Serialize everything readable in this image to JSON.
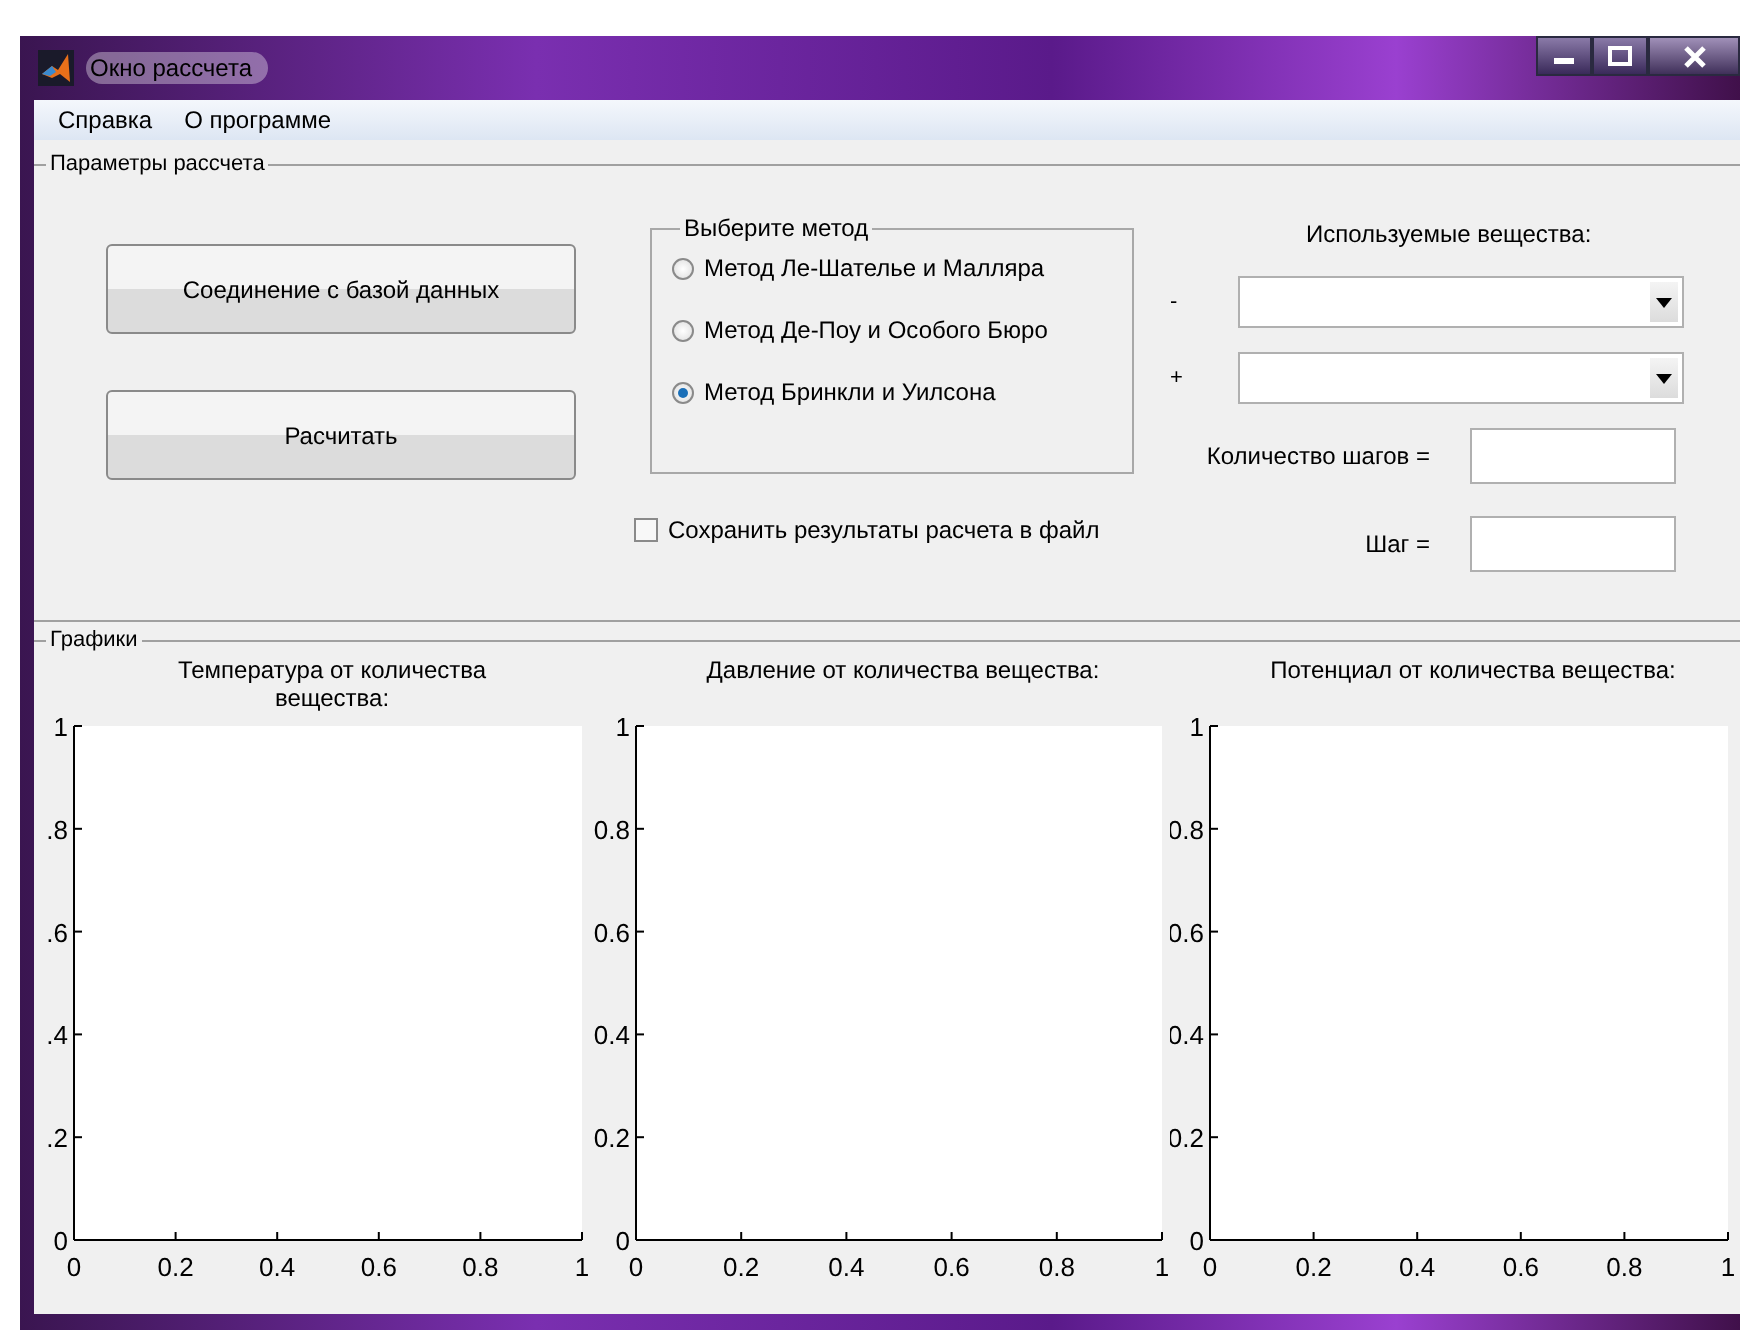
{
  "window": {
    "title": "Окно рассчета"
  },
  "menu": [
    "Справка",
    "О программе"
  ],
  "parameters_panel": {
    "title": "Параметры рассчета",
    "buttons": [
      "Соединение с базой данных",
      "Расчитать"
    ],
    "method_group": {
      "title": "Выберите метод",
      "options": [
        {
          "label": "Метод Ле-Шателье и Малляра",
          "selected": false
        },
        {
          "label": "Метод Де-Поу и Особого Бюро",
          "selected": false
        },
        {
          "label": "Метод Бринкли и Уилсона",
          "selected": true
        }
      ]
    },
    "save_checkbox": {
      "label": "Сохранить результаты расчета в файл",
      "checked": false
    },
    "substances": {
      "title": "Используемые вещества:",
      "dropdowns": [
        {
          "label": "-"
        },
        {
          "label": "+"
        }
      ]
    },
    "fields": [
      {
        "label": "Количество шагов ="
      },
      {
        "label": "Шаг ="
      }
    ]
  },
  "graphs_panel": {
    "title": "Графики",
    "charts": [
      {
        "chart_data": {
          "type": "line",
          "title": "Температура от количества вещества:",
          "xlim": [
            0,
            1
          ],
          "ylim": [
            0,
            1
          ],
          "xticks": [
            0,
            0.2,
            0.4,
            0.6,
            0.8,
            1
          ],
          "yticks": [
            {
              "value": 0,
              "label": "0"
            },
            {
              "value": 0.2,
              "label": ".2"
            },
            {
              "value": 0.4,
              "label": ".4"
            },
            {
              "value": 0.6,
              "label": ".6"
            },
            {
              "value": 0.8,
              "label": ".8"
            },
            {
              "value": 1,
              "label": "1"
            }
          ]
        }
      },
      {
        "chart_data": {
          "type": "line",
          "title": "Давление от количества вещества:",
          "xlim": [
            0,
            1
          ],
          "ylim": [
            0,
            1
          ],
          "xticks": [
            0,
            0.2,
            0.4,
            0.6,
            0.8,
            1
          ],
          "yticks": [
            0,
            0.2,
            0.4,
            0.6,
            0.8,
            1
          ]
        }
      },
      {
        "chart_data": {
          "type": "line",
          "title": "Потенциал от количества вещества:",
          "xlim": [
            0,
            1
          ],
          "ylim": [
            0,
            1
          ],
          "xticks": [
            0,
            0.2,
            0.4,
            0.6,
            0.8,
            1
          ],
          "yticks": [
            0,
            0.2,
            0.4,
            0.6,
            0.8,
            1
          ]
        }
      }
    ]
  }
}
